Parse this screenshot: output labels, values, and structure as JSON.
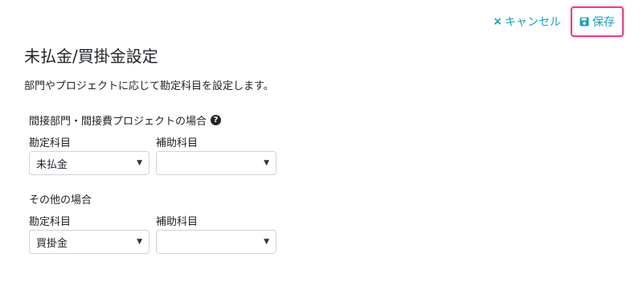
{
  "toolbar": {
    "cancel_icon": "×",
    "cancel_label": "キャンセル",
    "save_label": "保存",
    "accent_color": "#17a2b8",
    "highlight_color": "#e83e8c"
  },
  "page": {
    "title": "未払金/買掛金設定",
    "description": "部門やプロジェクトに応じて勘定科目を設定します。"
  },
  "sections": [
    {
      "title": "間接部門・間接費プロジェクトの場合",
      "help_icon": "?",
      "account_label": "勘定科目",
      "account_value": "未払金",
      "sub_account_label": "補助科目",
      "sub_account_value": ""
    },
    {
      "title": "その他の場合",
      "account_label": "勘定科目",
      "account_value": "買掛金",
      "sub_account_label": "補助科目",
      "sub_account_value": ""
    }
  ]
}
